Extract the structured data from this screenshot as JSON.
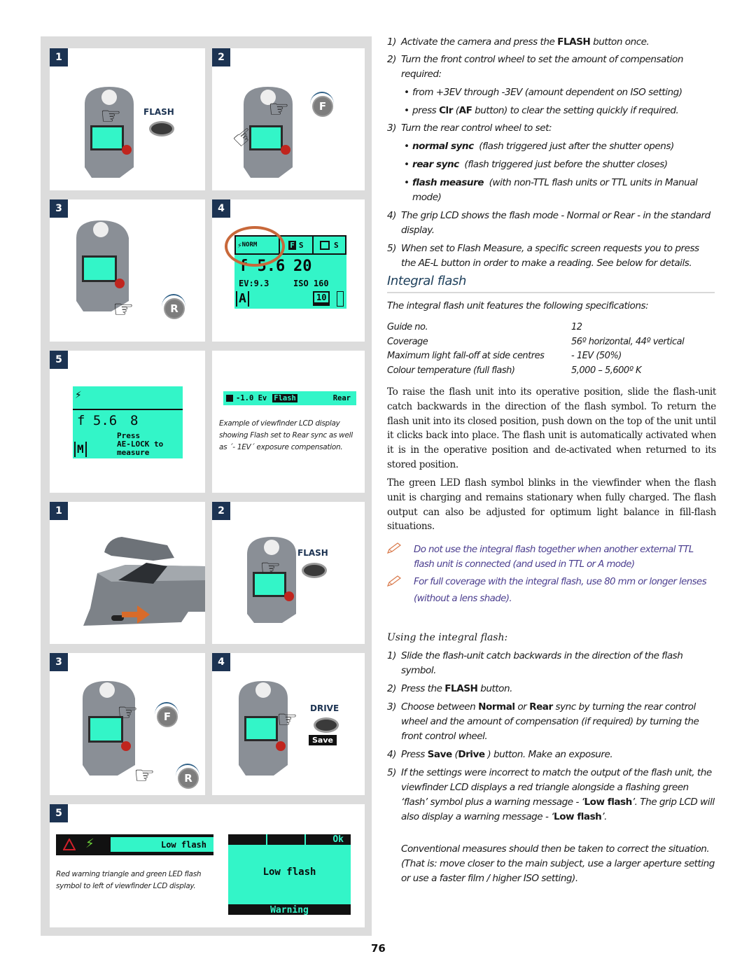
{
  "page_number": "76",
  "colors": {
    "badge": "#1c3352",
    "lcd": "#33f5c8",
    "heading": "#1c3e5a",
    "note_text": "#4b3e8f",
    "panel_frame": "#dcdcdc",
    "highlight_circle": "#c8683a"
  },
  "figures": {
    "set1": [
      {
        "badge": "1",
        "label": "FLASH",
        "icons": [
          "camera-grip",
          "pointing-hand",
          "flash-button"
        ]
      },
      {
        "badge": "2",
        "wheel": "F",
        "icons": [
          "camera-grip",
          "pointing-hand",
          "front-wheel"
        ]
      },
      {
        "badge": "3",
        "wheel": "R",
        "icons": [
          "camera-grip",
          "pointing-hand",
          "rear-wheel"
        ]
      },
      {
        "badge": "4",
        "lcd": {
          "mode": "NORM",
          "af": "S",
          "drive": "S",
          "aperture": "f 5.6",
          "shutter": "20",
          "ev": "EV:9.3",
          "iso": "ISO 160",
          "exposure_mode": "A",
          "frames": "10"
        }
      },
      {
        "badge": "5",
        "lcd": {
          "aperture": "f 5.6",
          "shutter": "8",
          "mode": "M",
          "message_lines": [
            "Press",
            "AE-LOCK to",
            "measure"
          ]
        }
      },
      {
        "viewfinder_lcd": {
          "comp": "-1.0 Ev",
          "flash": "Flash",
          "sync": "Rear"
        },
        "caption": "Example of viewfinder LCD display showing Flash set to Rear sync as well as ´- 1EV´ exposure compensation."
      }
    ],
    "set2": [
      {
        "badge": "1",
        "icons": [
          "integral-flash-raised",
          "slide-arrow"
        ]
      },
      {
        "badge": "2",
        "label": "FLASH",
        "icons": [
          "camera-grip",
          "pointing-hand",
          "flash-button"
        ]
      },
      {
        "badge": "3",
        "wheels": [
          "F",
          "R"
        ],
        "icons": [
          "camera-grip",
          "pointing-hand"
        ]
      },
      {
        "badge": "4",
        "label": "DRIVE",
        "sub_label": "Save",
        "icons": [
          "camera-grip",
          "pointing-hand",
          "drive-button"
        ]
      },
      {
        "badge": "5",
        "viewfinder_lcd": {
          "message": "Low flash"
        },
        "caption": "Red warning triangle and green LED flash symbol to left of viewfinder LCD display.",
        "grip_lcd": {
          "top_right": "Ok",
          "message": "Low flash",
          "bottom": "Warning"
        }
      }
    ]
  },
  "instructions_a": {
    "steps": [
      {
        "num": "1)",
        "pre": "Activate the camera and press the ",
        "kw": "FLASH",
        "post": " button once."
      },
      {
        "num": "2)",
        "text": "Turn the front control wheel to set the amount of compensation required:"
      },
      {
        "num": "3)",
        "text": "Turn the rear control wheel to set:"
      },
      {
        "num": "4)",
        "text": "The grip LCD shows the flash mode - Normal or Rear - in the standard display."
      },
      {
        "num": "5)",
        "text": "When set to Flash Measure, a specific screen requests you to press the AE-L button in order to make a reading. See below for details."
      }
    ],
    "bullets_step2": [
      {
        "text": "from +3EV through -3EV (amount dependent on ISO setting)"
      },
      {
        "pre": "press ",
        "kw1": "Clr",
        "mid": " (",
        "kw2": "AF",
        "post": " button) to clear the setting quickly if required."
      }
    ],
    "bullets_step3": [
      {
        "kw": "normal sync",
        "text": "(flash triggered just after the shutter opens)"
      },
      {
        "kw": "rear sync",
        "text": "(flash triggered just before the shutter closes)"
      },
      {
        "kw": "flash measure",
        "text": "(with non-TTL flash units or TTL units in Manual mode)"
      }
    ]
  },
  "integral_flash": {
    "heading": "Integral flash",
    "intro": "The integral flash unit features the following specifications:",
    "specs": [
      {
        "label": "Guide no.",
        "value": "12"
      },
      {
        "label": "Coverage",
        "value": "56º horizontal, 44º vertical"
      },
      {
        "label": "Maximum light fall-off at side centres",
        "value": "- 1EV (50%)"
      },
      {
        "label": "Colour temperature (full flash)",
        "value": "5,000 – 5,600º K"
      }
    ],
    "para1": "To raise the flash unit into its operative position, slide the flash-unit catch backwards in the direction of the flash symbol. To return the flash unit into its closed position, push down on the top of the unit until it clicks back into place. The flash unit is automatically activated when it is in the operative position and de-activated when returned to its stored position.",
    "para2": "The green LED flash symbol blinks in the viewfinder when the flash unit is charging and remains stationary when fully charged. The flash output can also be adjusted for optimum light balance in fill-flash situations.",
    "notes": [
      "Do not use the integral flash together when another external TTL flash unit is connected (and used in TTL or A mode)",
      "For full coverage with the integral flash, use 80 mm or longer lenses (without a lens shade)."
    ],
    "subheading": "Using the integral flash:"
  },
  "instructions_b": {
    "steps": [
      {
        "num": "1)",
        "text": "Slide the flash-unit catch backwards in the direction of the flash symbol."
      },
      {
        "num": "2)",
        "pre": "Press the ",
        "kw": "FLASH",
        "post": " button."
      },
      {
        "num": "3)",
        "pre": "Choose between ",
        "kw1": "Normal",
        "mid": " or ",
        "kw2": "Rear",
        "post": " sync by turning the rear control wheel and the amount of compensation (if required) by turning the front control wheel."
      },
      {
        "num": "4)",
        "pre": " Press ",
        "kw1": "Save",
        "mid": " (",
        "kw2": "Drive",
        "post": " ) button. Make an exposure."
      },
      {
        "num": "5)",
        "pre": "If the settings were incorrect to match the output of the flash unit, the viewfinder LCD displays a red triangle alongside a flashing green ‘flash’ symbol plus a warning message - ‘",
        "kw1": "Low flash",
        "mid": "’. The grip LCD will also display a warning message - ‘",
        "kw2": "Low flash",
        "post": "’."
      }
    ],
    "conclusion": "Conventional measures should then be taken to correct the situation. (That is: move closer to the main subject, use a larger aperture setting or use a faster film / higher ISO setting)."
  }
}
